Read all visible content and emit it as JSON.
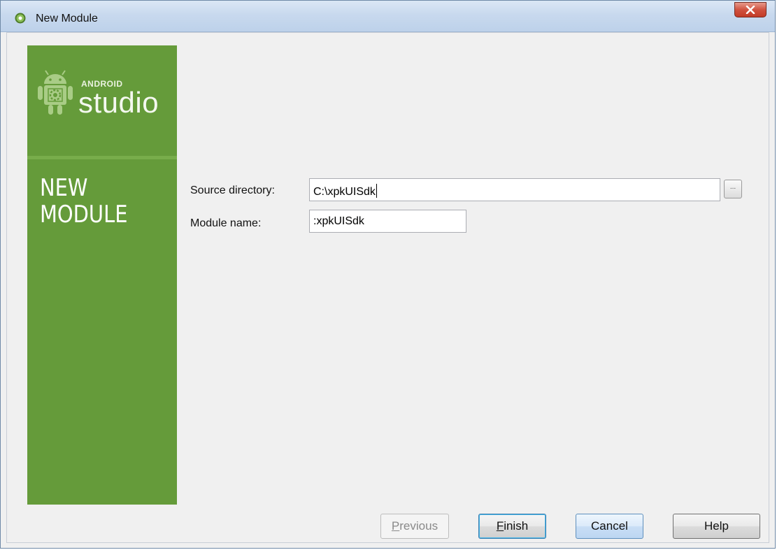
{
  "window": {
    "title": "New Module",
    "close_glyph": "✕"
  },
  "sidebar": {
    "logo_android": "ANDROID",
    "logo_studio": "studio",
    "heading_line1": "NEW",
    "heading_line2": "MODULE",
    "accent": "#659b3a"
  },
  "form": {
    "source_label": "Source directory:",
    "source_value": "C:\\xpkUISdk",
    "module_label": "Module name:",
    "module_value": ":xpkUISdk",
    "browse_label": "..."
  },
  "buttons": {
    "previous_access": "P",
    "previous_rest": "revious",
    "finish_access": "F",
    "finish_rest": "inish",
    "cancel": "Cancel",
    "help": "Help"
  },
  "icons": {
    "title": "android-studio-icon",
    "close": "close-icon",
    "logo": "android-robot-icon"
  }
}
